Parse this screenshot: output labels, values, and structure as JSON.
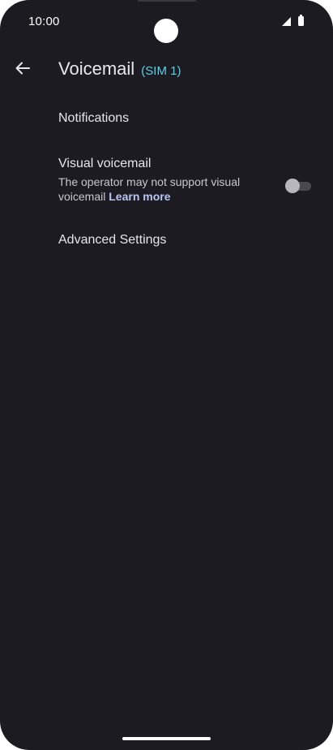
{
  "status_bar": {
    "time": "10:00",
    "signal_icon": "cell-signal-icon",
    "battery_icon": "battery-icon"
  },
  "header": {
    "back_icon": "arrow-back-icon",
    "title": "Voicemail",
    "title_suffix": "(SIM 1)"
  },
  "settings": {
    "notifications": {
      "title": "Notifications"
    },
    "visual_voicemail": {
      "title": "Visual voicemail",
      "summary": "The operator may not support visual voicemail",
      "link_text": "Learn more",
      "toggle_on": false
    },
    "advanced": {
      "title": "Advanced Settings"
    }
  },
  "colors": {
    "background": "#1c1b22",
    "accent_sim": "#5ed0e6",
    "link": "#b9c6f5"
  }
}
